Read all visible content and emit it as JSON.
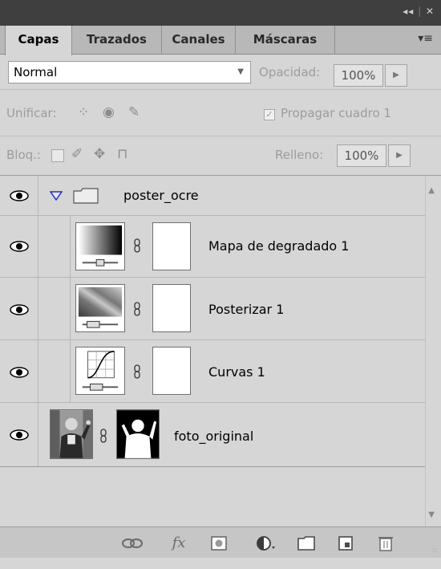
{
  "panel": {
    "collapse_label": "◂◂",
    "close_label": "✕"
  },
  "tabs": [
    {
      "label": "Capas",
      "active": true
    },
    {
      "label": "Trazados",
      "active": false
    },
    {
      "label": "Canales",
      "active": false
    },
    {
      "label": "Máscaras",
      "active": false
    }
  ],
  "tab_menu_icon": "panel-menu-icon",
  "blend_mode": "Normal",
  "opacity": {
    "label": "Opacidad:",
    "value": "100%"
  },
  "unify": {
    "label": "Unificar:",
    "icons": [
      "unify-position-icon",
      "unify-visibility-icon",
      "unify-style-icon"
    ]
  },
  "propagate": {
    "label": "Propagar cuadro 1",
    "checked": true
  },
  "lock": {
    "label": "Bloq.:",
    "icons": [
      "lock-transparency-icon",
      "lock-pixels-icon",
      "lock-position-icon",
      "lock-all-icon"
    ]
  },
  "fill": {
    "label": "Relleno:",
    "value": "100%"
  },
  "layers": [
    {
      "name": "poster_ocre",
      "kind": "group",
      "visible": true,
      "expanded": true
    },
    {
      "name": "Mapa de degradado 1",
      "kind": "adjustment",
      "thumb": "gradient-map",
      "visible": true
    },
    {
      "name": "Posterizar 1",
      "kind": "adjustment",
      "thumb": "posterize",
      "visible": true
    },
    {
      "name": "Curvas 1",
      "kind": "adjustment",
      "thumb": "curves",
      "visible": true
    },
    {
      "name": "foto_original",
      "kind": "image",
      "visible": true
    }
  ],
  "bottom_icons": [
    "link-layers-icon",
    "fx-icon",
    "add-mask-icon",
    "adjustment-layer-icon",
    "new-group-icon",
    "new-layer-icon",
    "trash-icon"
  ],
  "fx_label": "fx"
}
